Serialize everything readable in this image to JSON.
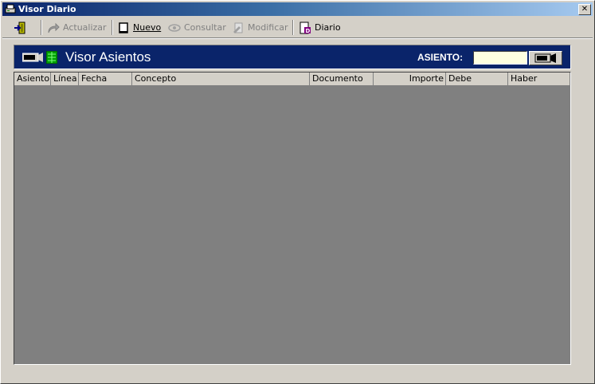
{
  "window": {
    "title": "Visor Diario",
    "close_glyph": "✕"
  },
  "toolbar": {
    "exit_icon": "exit-door-icon",
    "actualizar": "Actualizar",
    "nuevo": "Nuevo",
    "consultar": "Consultar",
    "modificar": "Modificar",
    "diario": "Diario"
  },
  "header": {
    "title": "Visor Asientos",
    "asiento_label": "ASIENTO:",
    "asiento_value": ""
  },
  "grid": {
    "columns": [
      "Asiento",
      "Línea",
      "Fecha",
      "Concepto",
      "Documento",
      "Importe",
      "Debe",
      "Haber"
    ],
    "rows": []
  },
  "colors": {
    "header_bg": "#0a246a",
    "grid_bg": "#808080",
    "window_bg": "#d4d0c8",
    "input_bg": "#ffffe1"
  }
}
